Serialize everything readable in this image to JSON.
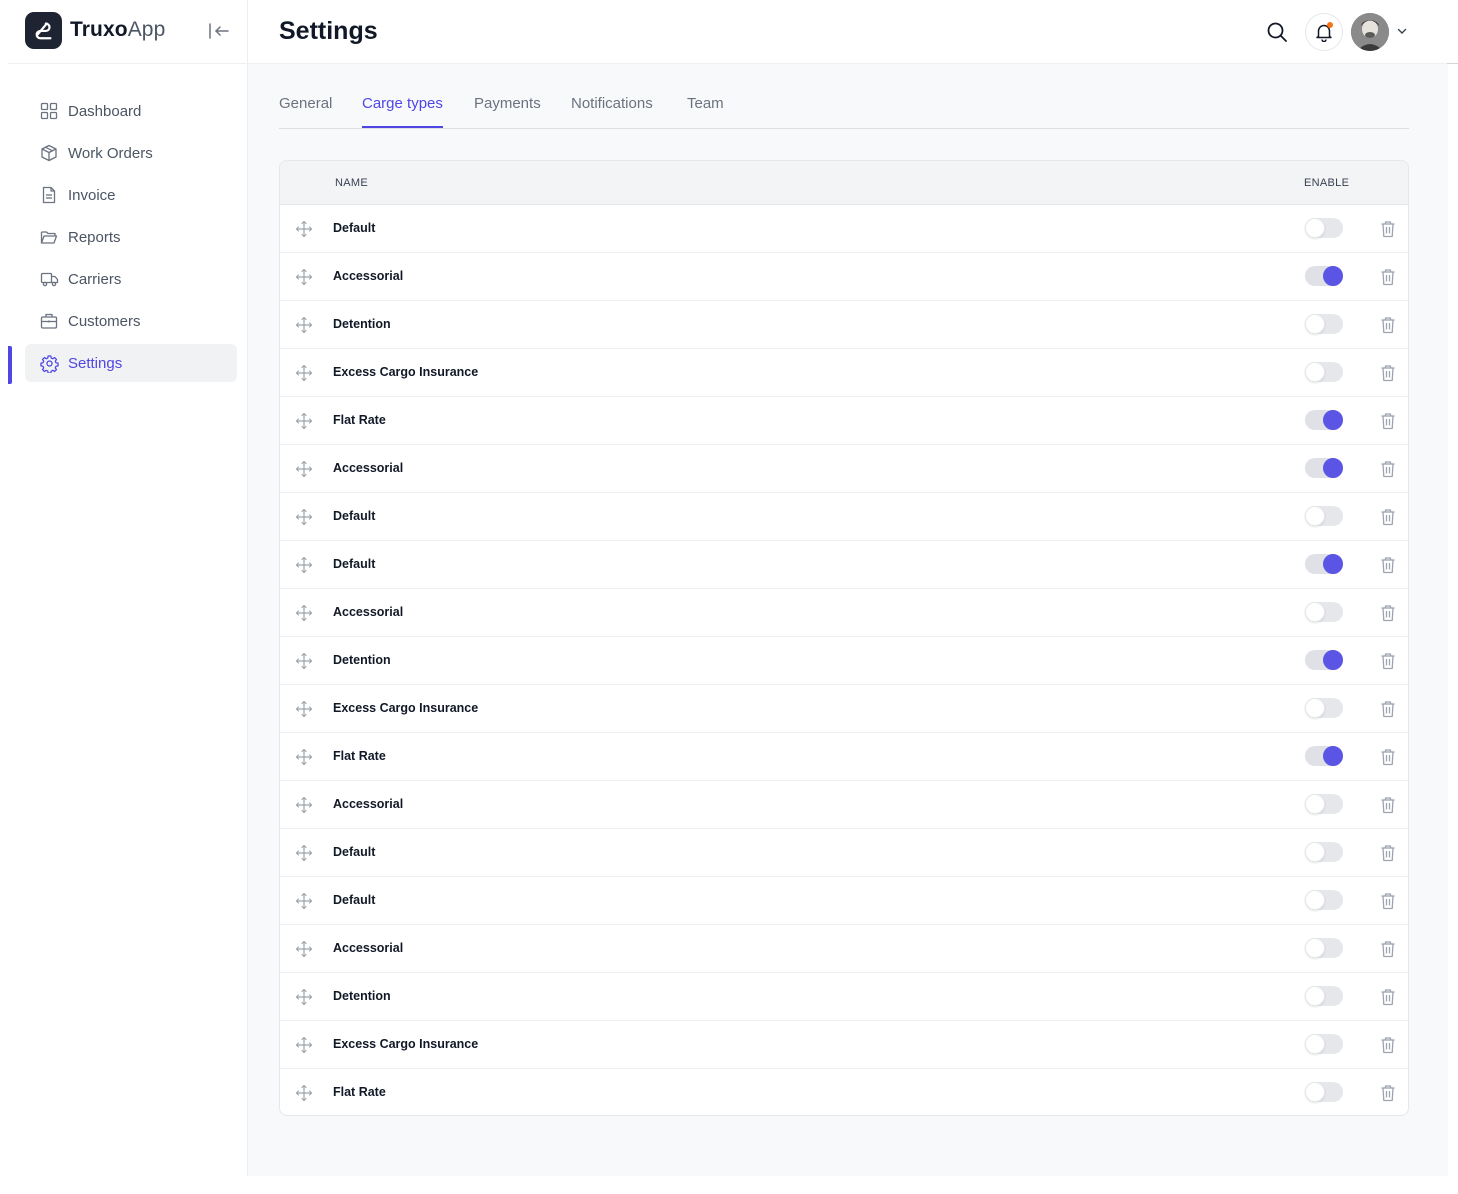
{
  "app": {
    "brand_bold": "Truxo",
    "brand_light": "App"
  },
  "sidebar": {
    "items": [
      {
        "label": "Dashboard",
        "icon": "dashboard-icon",
        "active": false
      },
      {
        "label": "Work Orders",
        "icon": "box-icon",
        "active": false
      },
      {
        "label": "Invoice",
        "icon": "document-icon",
        "active": false
      },
      {
        "label": "Reports",
        "icon": "folder-icon",
        "active": false
      },
      {
        "label": "Carriers",
        "icon": "truck-icon",
        "active": false
      },
      {
        "label": "Customers",
        "icon": "briefcase-icon",
        "active": false
      },
      {
        "label": "Settings",
        "icon": "gear-icon",
        "active": true
      }
    ]
  },
  "header": {
    "title": "Settings"
  },
  "tabs": [
    {
      "label": "General",
      "active": false
    },
    {
      "label": "Carge types",
      "active": true
    },
    {
      "label": "Payments",
      "active": false
    },
    {
      "label": "Notifications",
      "active": false
    },
    {
      "label": "Team",
      "active": false
    }
  ],
  "table": {
    "columns": {
      "name": "NAME",
      "enable": "ENABLE"
    },
    "rows": [
      {
        "name": "Default",
        "enabled": false
      },
      {
        "name": "Accessorial",
        "enabled": true
      },
      {
        "name": "Detention",
        "enabled": false
      },
      {
        "name": "Excess Cargo Insurance",
        "enabled": false
      },
      {
        "name": "Flat Rate",
        "enabled": true
      },
      {
        "name": "Accessorial",
        "enabled": true
      },
      {
        "name": "Default",
        "enabled": false
      },
      {
        "name": "Default",
        "enabled": true
      },
      {
        "name": "Accessorial",
        "enabled": false
      },
      {
        "name": "Detention",
        "enabled": true
      },
      {
        "name": "Excess Cargo Insurance",
        "enabled": false
      },
      {
        "name": "Flat Rate",
        "enabled": true
      },
      {
        "name": "Accessorial",
        "enabled": false
      },
      {
        "name": "Default",
        "enabled": false
      },
      {
        "name": "Default",
        "enabled": false
      },
      {
        "name": "Accessorial",
        "enabled": false
      },
      {
        "name": "Detention",
        "enabled": false
      },
      {
        "name": "Excess Cargo Insurance",
        "enabled": false
      },
      {
        "name": "Flat Rate",
        "enabled": false
      }
    ]
  },
  "colors": {
    "accent": "#4f46e5",
    "toggle_on": "#5b55e6",
    "notification_dot": "#f97316"
  }
}
